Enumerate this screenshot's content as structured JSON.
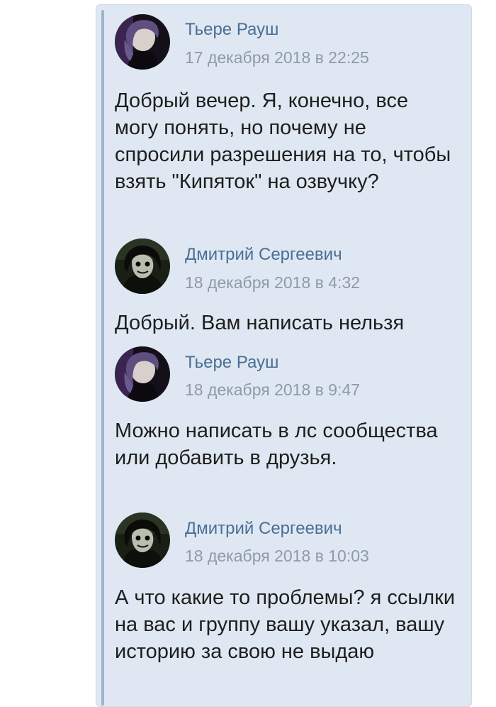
{
  "comments": [
    {
      "author": "Тьере Рауш",
      "timestamp": "17 декабря 2018 в 22:25",
      "text": "Добрый вечер. Я, конечно, все могу понять, но почему не спросили разрешения на то, чтобы взять \"Кипяток\" на озвучку?",
      "avatar_icon": "user-photo-avatar-icon"
    },
    {
      "author": "Дмитрий Сергеевич",
      "timestamp": "18 декабря 2018 в 4:32",
      "text": "Добрый. Вам написать нельзя",
      "avatar_icon": "user-photo-avatar-icon"
    },
    {
      "author": "Тьере Рауш",
      "timestamp": "18 декабря 2018 в 9:47",
      "text": "Можно написать в лс сообщества или добавить в друзья.",
      "avatar_icon": "user-photo-avatar-icon"
    },
    {
      "author": "Дмитрий Сергеевич",
      "timestamp": "18 декабря 2018 в 10:03",
      "text": "А что какие то проблемы? я ссылки на вас и группу вашу указал, вашу историю за свою не выдаю",
      "avatar_icon": "user-photo-avatar-icon"
    }
  ],
  "colors": {
    "author_name": "#4a6e94",
    "timestamp": "#8f9aa6",
    "panel_background": "#dfe8f2",
    "thread_bar": "#9fb5cd"
  }
}
